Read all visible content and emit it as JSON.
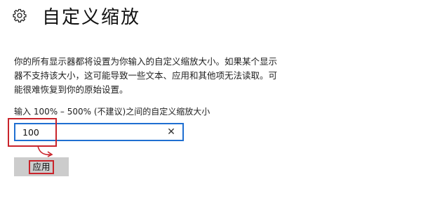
{
  "header": {
    "title": "自定义缩放",
    "icon": "gear-icon"
  },
  "description": "你的所有显示器都将设置为你输入的自定义缩放大小。如果某个显示器不支持该大小，这可能导致一些文本、应用和其他项无法读取。可能很难恢复到你的原始设置。",
  "scale_input": {
    "label": "输入 100% – 500% (不建议)之间的自定义缩放大小",
    "value": "100",
    "clear_glyph": "✕"
  },
  "apply_button": {
    "label": "应用"
  },
  "colors": {
    "accent": "#1f6fd1",
    "annotation": "#c9242b",
    "button_bg": "#cccccc"
  }
}
